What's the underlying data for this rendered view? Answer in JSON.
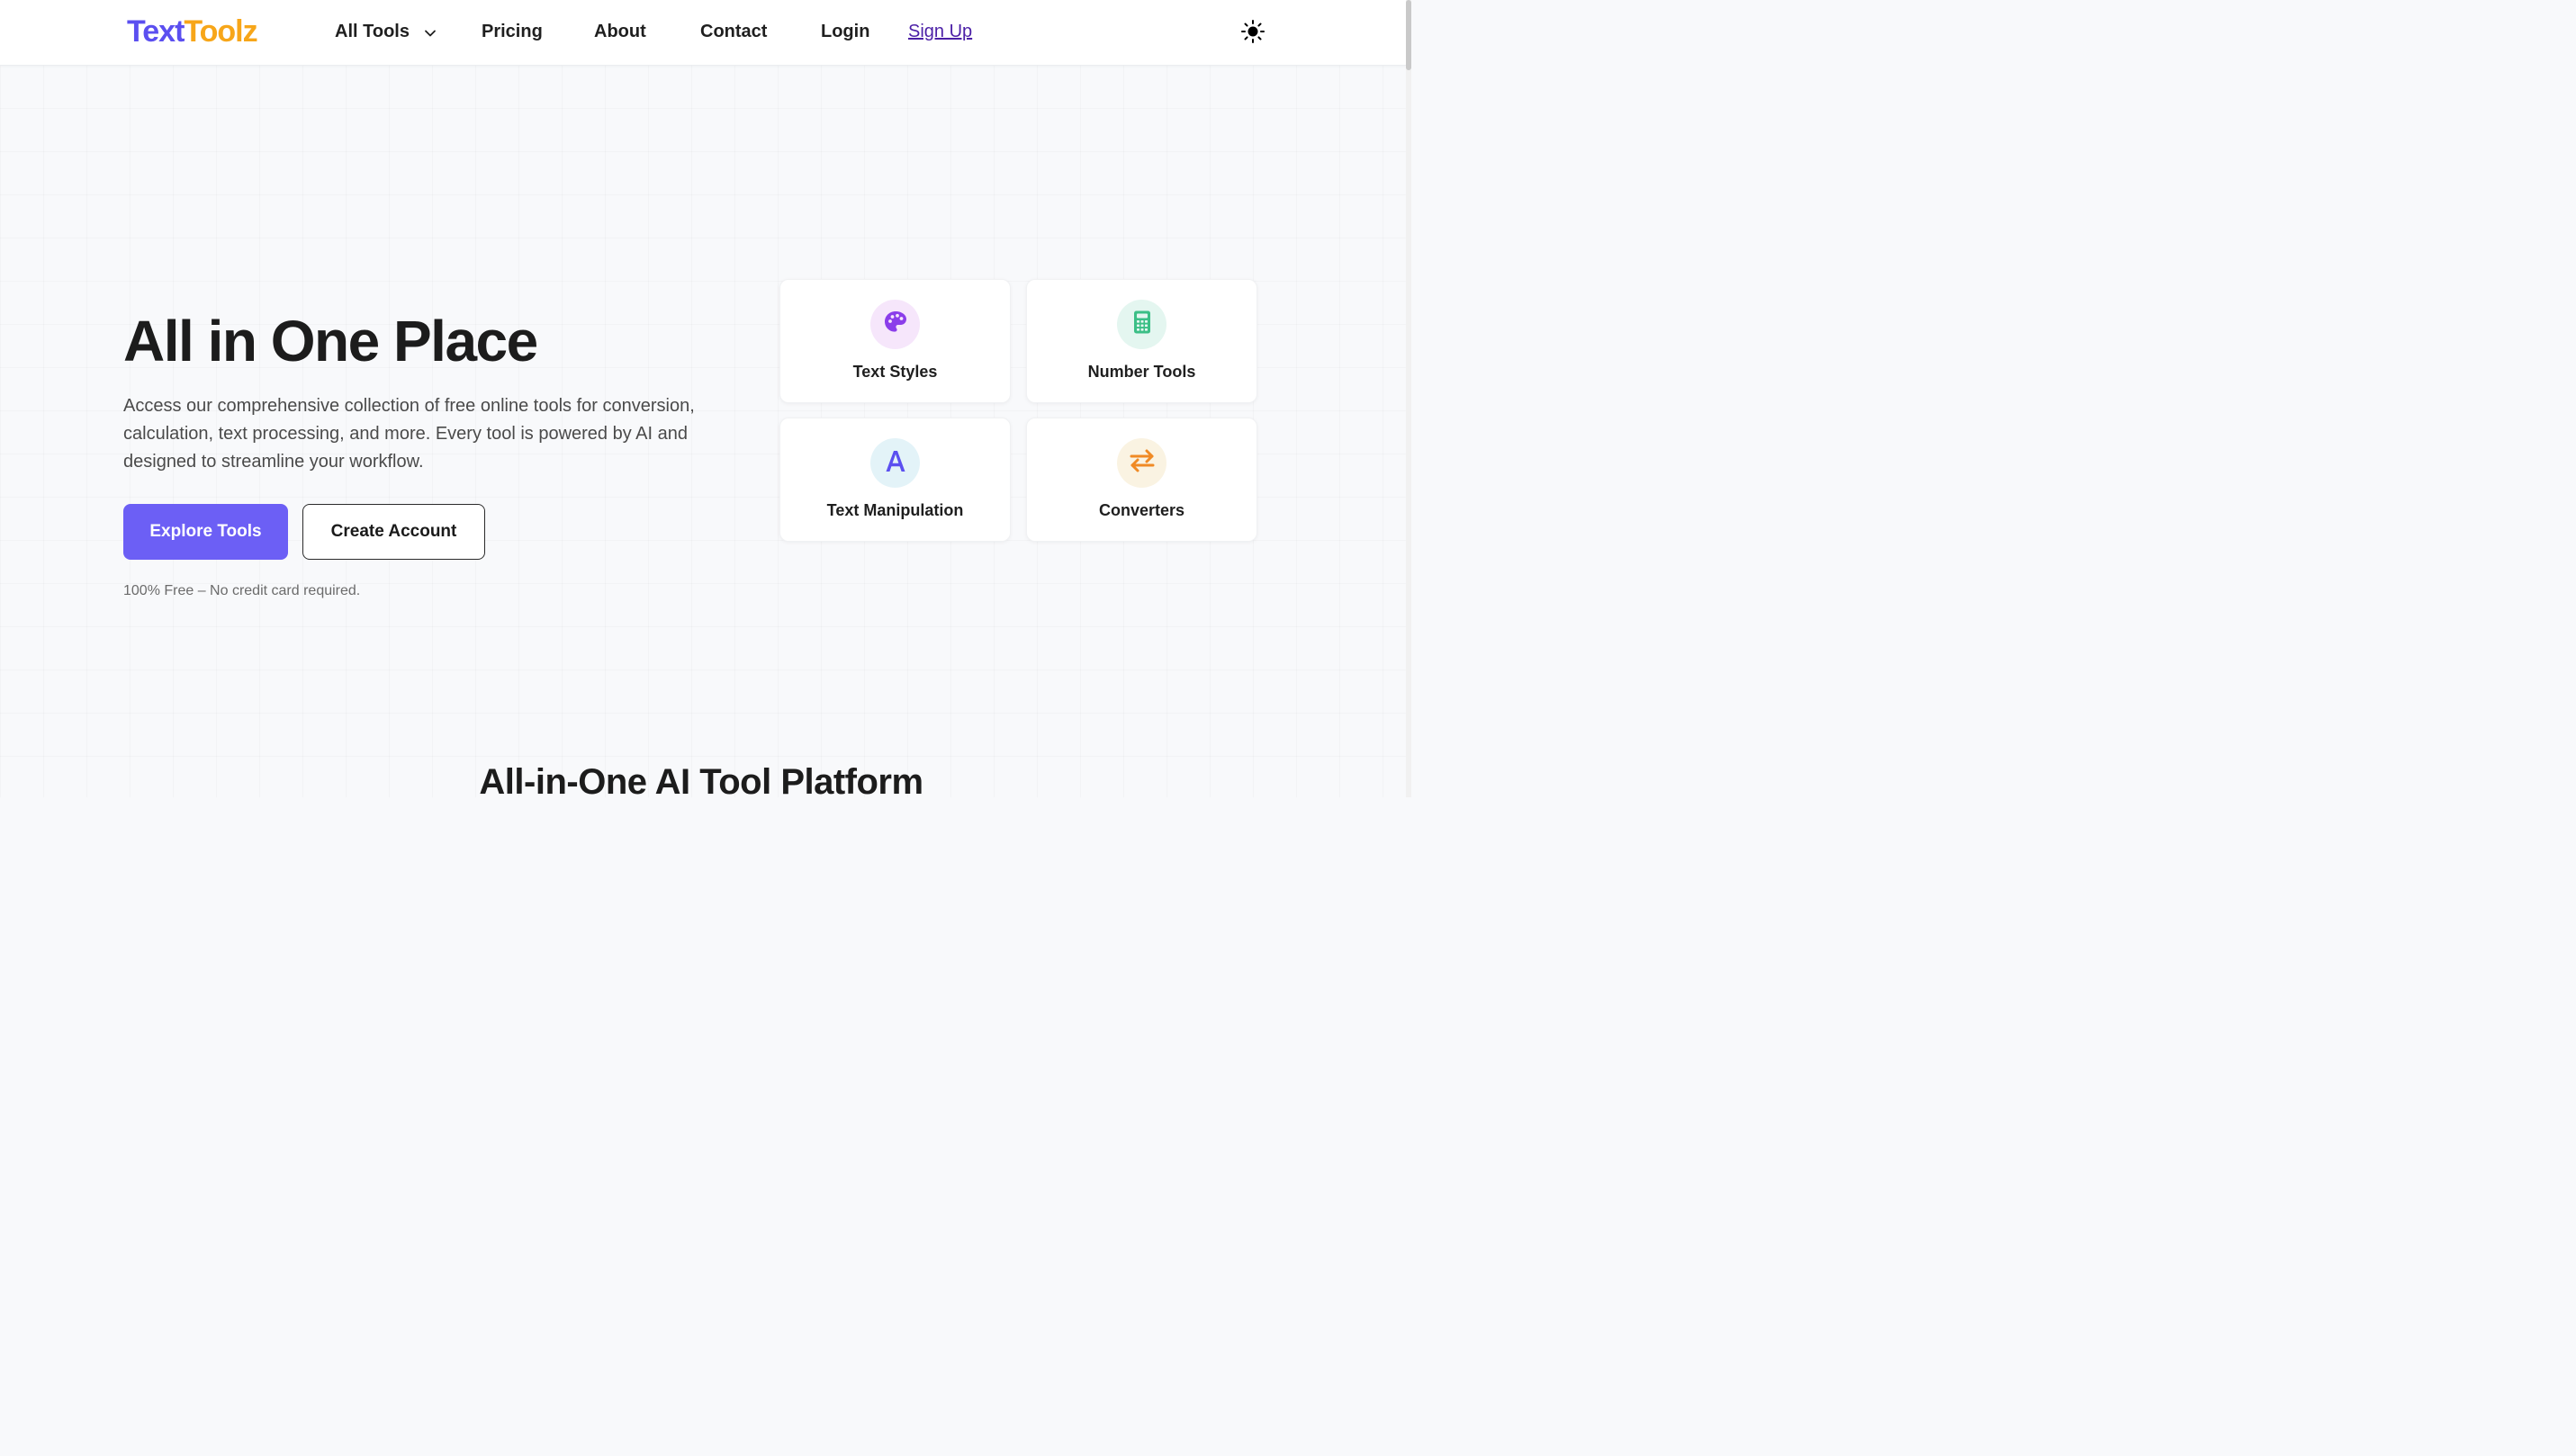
{
  "header": {
    "logo": {
      "part1": "Text",
      "part2": "Toolz"
    },
    "nav": {
      "all_tools": "All Tools",
      "pricing": "Pricing",
      "about": "About",
      "contact": "Contact",
      "login": "Login",
      "signup": "Sign Up"
    },
    "theme_icon": "sun-icon"
  },
  "hero": {
    "title": "All in One Place",
    "description": "Access our comprehensive collection of free online tools for conversion, calculation, text processing, and more. Every tool is powered by AI and designed to streamline your workflow.",
    "primary_button": "Explore Tools",
    "secondary_button": "Create Account",
    "note": "100% Free – No credit card required."
  },
  "categories": [
    {
      "label": "Text Styles",
      "icon": "palette-icon",
      "icon_color": "#8b3dea",
      "bg_color": "#f6e6fb"
    },
    {
      "label": "Number Tools",
      "icon": "calculator-icon",
      "icon_color": "#3bbf86",
      "bg_color": "#e4f6f0"
    },
    {
      "label": "Text Manipulation",
      "icon": "letter-a-icon",
      "icon_color": "#5b4ff0",
      "bg_color": "#e3f3f8"
    },
    {
      "label": "Converters",
      "icon": "exchange-arrows-icon",
      "icon_color": "#f08a24",
      "bg_color": "#faf3e2"
    }
  ],
  "section": {
    "title": "All-in-One AI Tool Platform"
  },
  "colors": {
    "brand_primary": "#5b4ff0",
    "brand_accent": "#f7a619",
    "button_primary": "#6c5ff5",
    "signup_link": "#4b1fa6"
  }
}
